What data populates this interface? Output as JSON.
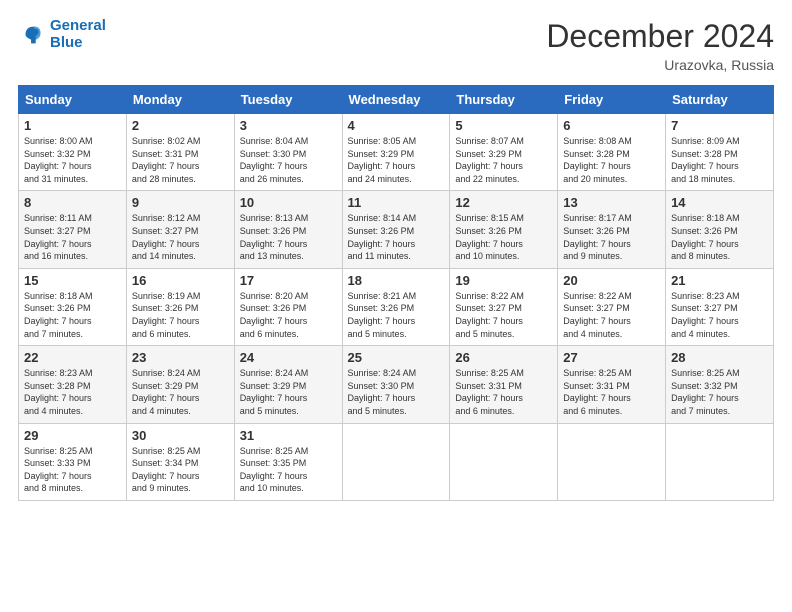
{
  "header": {
    "logo_line1": "General",
    "logo_line2": "Blue",
    "month": "December 2024",
    "location": "Urazovka, Russia"
  },
  "days_of_week": [
    "Sunday",
    "Monday",
    "Tuesday",
    "Wednesday",
    "Thursday",
    "Friday",
    "Saturday"
  ],
  "weeks": [
    [
      {
        "day": "1",
        "info": "Sunrise: 8:00 AM\nSunset: 3:32 PM\nDaylight: 7 hours\nand 31 minutes."
      },
      {
        "day": "2",
        "info": "Sunrise: 8:02 AM\nSunset: 3:31 PM\nDaylight: 7 hours\nand 28 minutes."
      },
      {
        "day": "3",
        "info": "Sunrise: 8:04 AM\nSunset: 3:30 PM\nDaylight: 7 hours\nand 26 minutes."
      },
      {
        "day": "4",
        "info": "Sunrise: 8:05 AM\nSunset: 3:29 PM\nDaylight: 7 hours\nand 24 minutes."
      },
      {
        "day": "5",
        "info": "Sunrise: 8:07 AM\nSunset: 3:29 PM\nDaylight: 7 hours\nand 22 minutes."
      },
      {
        "day": "6",
        "info": "Sunrise: 8:08 AM\nSunset: 3:28 PM\nDaylight: 7 hours\nand 20 minutes."
      },
      {
        "day": "7",
        "info": "Sunrise: 8:09 AM\nSunset: 3:28 PM\nDaylight: 7 hours\nand 18 minutes."
      }
    ],
    [
      {
        "day": "8",
        "info": "Sunrise: 8:11 AM\nSunset: 3:27 PM\nDaylight: 7 hours\nand 16 minutes."
      },
      {
        "day": "9",
        "info": "Sunrise: 8:12 AM\nSunset: 3:27 PM\nDaylight: 7 hours\nand 14 minutes."
      },
      {
        "day": "10",
        "info": "Sunrise: 8:13 AM\nSunset: 3:26 PM\nDaylight: 7 hours\nand 13 minutes."
      },
      {
        "day": "11",
        "info": "Sunrise: 8:14 AM\nSunset: 3:26 PM\nDaylight: 7 hours\nand 11 minutes."
      },
      {
        "day": "12",
        "info": "Sunrise: 8:15 AM\nSunset: 3:26 PM\nDaylight: 7 hours\nand 10 minutes."
      },
      {
        "day": "13",
        "info": "Sunrise: 8:17 AM\nSunset: 3:26 PM\nDaylight: 7 hours\nand 9 minutes."
      },
      {
        "day": "14",
        "info": "Sunrise: 8:18 AM\nSunset: 3:26 PM\nDaylight: 7 hours\nand 8 minutes."
      }
    ],
    [
      {
        "day": "15",
        "info": "Sunrise: 8:18 AM\nSunset: 3:26 PM\nDaylight: 7 hours\nand 7 minutes."
      },
      {
        "day": "16",
        "info": "Sunrise: 8:19 AM\nSunset: 3:26 PM\nDaylight: 7 hours\nand 6 minutes."
      },
      {
        "day": "17",
        "info": "Sunrise: 8:20 AM\nSunset: 3:26 PM\nDaylight: 7 hours\nand 6 minutes."
      },
      {
        "day": "18",
        "info": "Sunrise: 8:21 AM\nSunset: 3:26 PM\nDaylight: 7 hours\nand 5 minutes."
      },
      {
        "day": "19",
        "info": "Sunrise: 8:22 AM\nSunset: 3:27 PM\nDaylight: 7 hours\nand 5 minutes."
      },
      {
        "day": "20",
        "info": "Sunrise: 8:22 AM\nSunset: 3:27 PM\nDaylight: 7 hours\nand 4 minutes."
      },
      {
        "day": "21",
        "info": "Sunrise: 8:23 AM\nSunset: 3:27 PM\nDaylight: 7 hours\nand 4 minutes."
      }
    ],
    [
      {
        "day": "22",
        "info": "Sunrise: 8:23 AM\nSunset: 3:28 PM\nDaylight: 7 hours\nand 4 minutes."
      },
      {
        "day": "23",
        "info": "Sunrise: 8:24 AM\nSunset: 3:29 PM\nDaylight: 7 hours\nand 4 minutes."
      },
      {
        "day": "24",
        "info": "Sunrise: 8:24 AM\nSunset: 3:29 PM\nDaylight: 7 hours\nand 5 minutes."
      },
      {
        "day": "25",
        "info": "Sunrise: 8:24 AM\nSunset: 3:30 PM\nDaylight: 7 hours\nand 5 minutes."
      },
      {
        "day": "26",
        "info": "Sunrise: 8:25 AM\nSunset: 3:31 PM\nDaylight: 7 hours\nand 6 minutes."
      },
      {
        "day": "27",
        "info": "Sunrise: 8:25 AM\nSunset: 3:31 PM\nDaylight: 7 hours\nand 6 minutes."
      },
      {
        "day": "28",
        "info": "Sunrise: 8:25 AM\nSunset: 3:32 PM\nDaylight: 7 hours\nand 7 minutes."
      }
    ],
    [
      {
        "day": "29",
        "info": "Sunrise: 8:25 AM\nSunset: 3:33 PM\nDaylight: 7 hours\nand 8 minutes."
      },
      {
        "day": "30",
        "info": "Sunrise: 8:25 AM\nSunset: 3:34 PM\nDaylight: 7 hours\nand 9 minutes."
      },
      {
        "day": "31",
        "info": "Sunrise: 8:25 AM\nSunset: 3:35 PM\nDaylight: 7 hours\nand 10 minutes."
      },
      {
        "day": "",
        "info": ""
      },
      {
        "day": "",
        "info": ""
      },
      {
        "day": "",
        "info": ""
      },
      {
        "day": "",
        "info": ""
      }
    ]
  ]
}
